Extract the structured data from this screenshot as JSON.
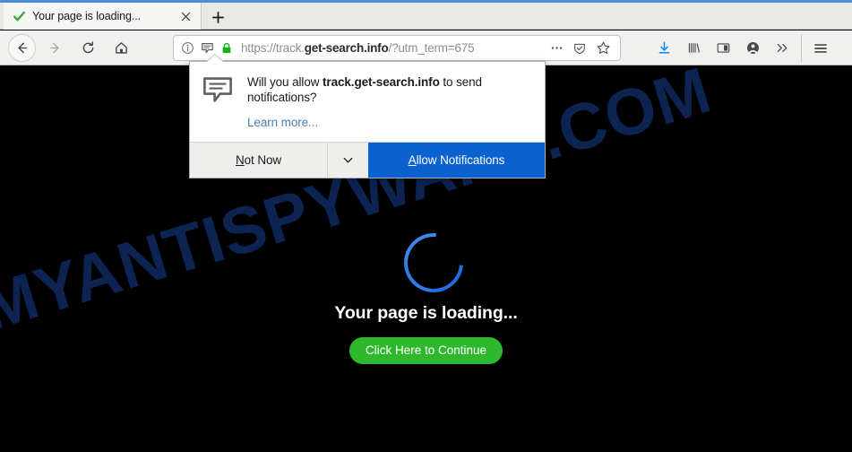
{
  "browser": {
    "accent_color": "#4a8fd8",
    "tab": {
      "title": "Your page is loading...",
      "status_icon": "check-icon",
      "close_icon": "close-icon"
    },
    "new_tab_label": "+",
    "nav": {
      "back_label": "Back",
      "forward_label": "Forward",
      "reload_label": "Reload",
      "home_label": "Home"
    },
    "urlbar": {
      "url_prefix": "https://track.",
      "url_domain": "get-search.info",
      "url_suffix": "/?utm_term=675",
      "full_url": "https://track.get-search.info/?utm_term=675",
      "info_icon": "info-icon",
      "notification_icon": "notification-bubble-icon",
      "lock_icon": "padlock-icon",
      "lock_color": "#12b212",
      "page_actions_icon": "ellipsis-icon",
      "reader_icon": "shield-icon",
      "bookmark_icon": "star-icon"
    },
    "toolbar_icons": [
      {
        "name": "downloads-icon",
        "color": "#0a84ff"
      },
      {
        "name": "library-icon",
        "color": "#4a4a4a"
      },
      {
        "name": "sidebar-icon",
        "color": "#4a4a4a"
      },
      {
        "name": "account-icon",
        "color": "#4a4a4a"
      },
      {
        "name": "overflow-chevrons-icon",
        "color": "#4a4a4a"
      },
      {
        "name": "hamburger-menu-icon",
        "color": "#2a2a2a"
      }
    ]
  },
  "popup": {
    "icon": "notification-bubble-icon",
    "question_lead": "Will you allow ",
    "question_domain": "track.get-search.info",
    "question_tail": " to send notifications?",
    "learn_more": "Learn more...",
    "not_now_first": "N",
    "not_now_rest": "ot Now",
    "dropdown_icon": "chevron-down-icon",
    "allow_first": "A",
    "allow_rest": "llow Notifications",
    "allow_bg": "#0a62d0"
  },
  "page": {
    "background": "#000000",
    "watermark": "MYANTISPYWARE.COM",
    "watermark_color": "#0d2452",
    "spinner_color": "#1f6fe0",
    "loading_text": "Your page is loading...",
    "cta_label": "Click Here to Continue",
    "cta_color": "#2eb82e"
  }
}
